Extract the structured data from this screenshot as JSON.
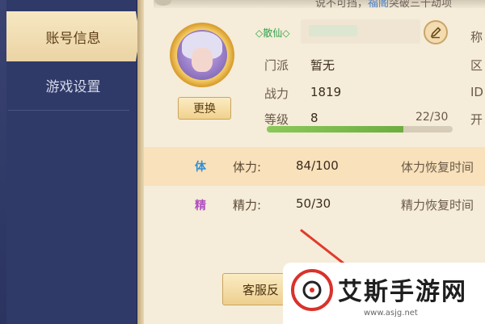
{
  "top": {
    "text_prefix": "说不可挡，",
    "text_highlight": "福阁",
    "text_suffix": "突破三十劫项"
  },
  "sidebar": {
    "items": [
      {
        "label": "账号信息",
        "active": true
      },
      {
        "label": "游戏设置",
        "active": false
      }
    ]
  },
  "profile": {
    "swap_label": "更换",
    "name_badge": "◇散仙◇",
    "fields": [
      {
        "label": "门派",
        "value": "暂无"
      },
      {
        "label": "战力",
        "value": "1819"
      },
      {
        "label": "等级",
        "value": "8"
      }
    ],
    "level_progress_text": "22/30",
    "level_progress": 0.733,
    "right_labels": [
      "称",
      "区",
      "ID",
      "开"
    ]
  },
  "resources": [
    {
      "icon_text": "体",
      "label": "体力:",
      "value": "84/100",
      "right": "体力恢复时间"
    },
    {
      "icon_text": "精",
      "label": "精力:",
      "value": "50/30",
      "right": "精力恢复时间"
    }
  ],
  "footer": {
    "service_label": "客服反",
    "watermark_title": "艾斯手游网",
    "watermark_url": "www.asjg.net"
  },
  "colors": {
    "accent_green": "#6cae40",
    "arrow_red": "#e23a2b",
    "sidebar_bg": "#2f3a68"
  }
}
